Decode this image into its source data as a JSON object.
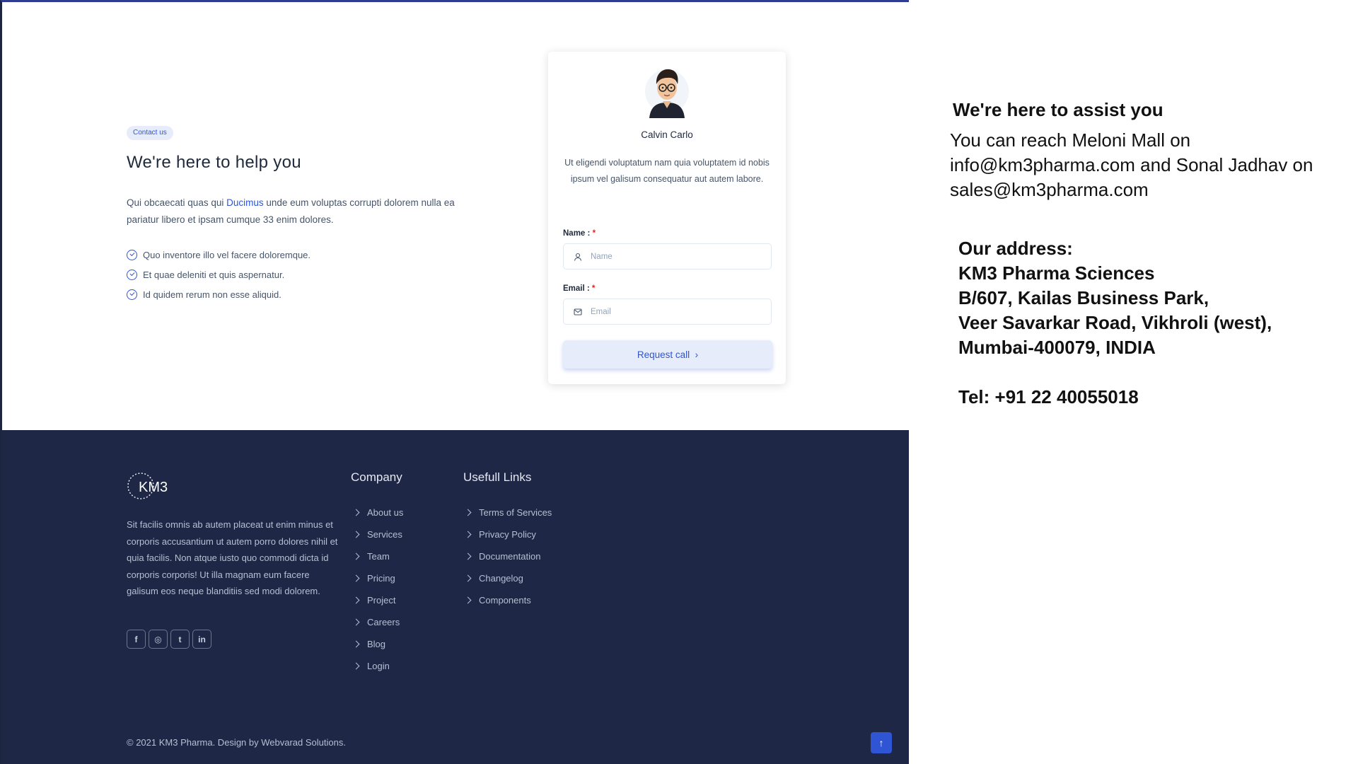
{
  "contact": {
    "badge": "Contact us",
    "title": "We're here to help you",
    "text_before": "Qui obcaecati quas qui ",
    "text_highlight": "Ducimus",
    "text_after": " unde eum voluptas corrupti dolorem nulla ea pariatur libero et ipsam cumque 33 enim dolores.",
    "checks": [
      "Quo inventore illo vel facere doloremque.",
      "Et quae deleniti et quis aspernatur.",
      "Id quidem rerum non esse aliquid."
    ]
  },
  "card": {
    "name": "Calvin Carlo",
    "text": "Ut eligendi voluptatum nam quia voluptatem id nobis ipsum vel galisum consequatur aut autem labore.",
    "name_label": "Name :",
    "name_placeholder": "Name",
    "email_label": "Email :",
    "email_placeholder": "Email",
    "required_mark": "*",
    "button_label": "Request call",
    "button_chevron": "›"
  },
  "footer": {
    "logo_text": "KM3",
    "description": "Sit facilis omnis ab autem placeat ut enim minus et corporis accusantium ut autem porro dolores nihil et quia facilis. Non atque iusto quo commodi dicta id corporis corporis! Ut illa magnam eum facere galisum eos neque blanditiis sed modi dolorem.",
    "socials": [
      {
        "icon": "facebook-icon",
        "glyph": "f"
      },
      {
        "icon": "instagram-icon",
        "glyph": "◎"
      },
      {
        "icon": "twitter-icon",
        "glyph": "t"
      },
      {
        "icon": "linkedin-icon",
        "glyph": "in"
      }
    ],
    "company_title": "Company",
    "company_links": [
      "About us",
      "Services",
      "Team",
      "Pricing",
      "Project",
      "Careers",
      "Blog",
      "Login"
    ],
    "useful_title": "Usefull Links",
    "useful_links": [
      "Terms of Services",
      "Privacy Policy",
      "Documentation",
      "Changelog",
      "Components"
    ],
    "copyright": "© 2021 KM3 Pharma. Design by Webvarad Solutions.",
    "back_to_top": "↑"
  },
  "info": {
    "assist_title": "We're here to assist you",
    "assist_lines": [
      "You can reach Meloni Mall on",
      "info@km3pharma.com and Sonal Jadhav on",
      "sales@km3pharma.com"
    ],
    "address_lines": [
      "Our address:",
      "KM3 Pharma Sciences",
      "B/607, Kailas Business Park,",
      "Veer Savarkar Road, Vikhroli (west),",
      "Mumbai-400079, INDIA"
    ],
    "tel": "Tel: +91 22 40055018"
  },
  "colors": {
    "accent": "#2f55d4",
    "footer_bg": "#1e2745",
    "required": "#dc2626"
  }
}
